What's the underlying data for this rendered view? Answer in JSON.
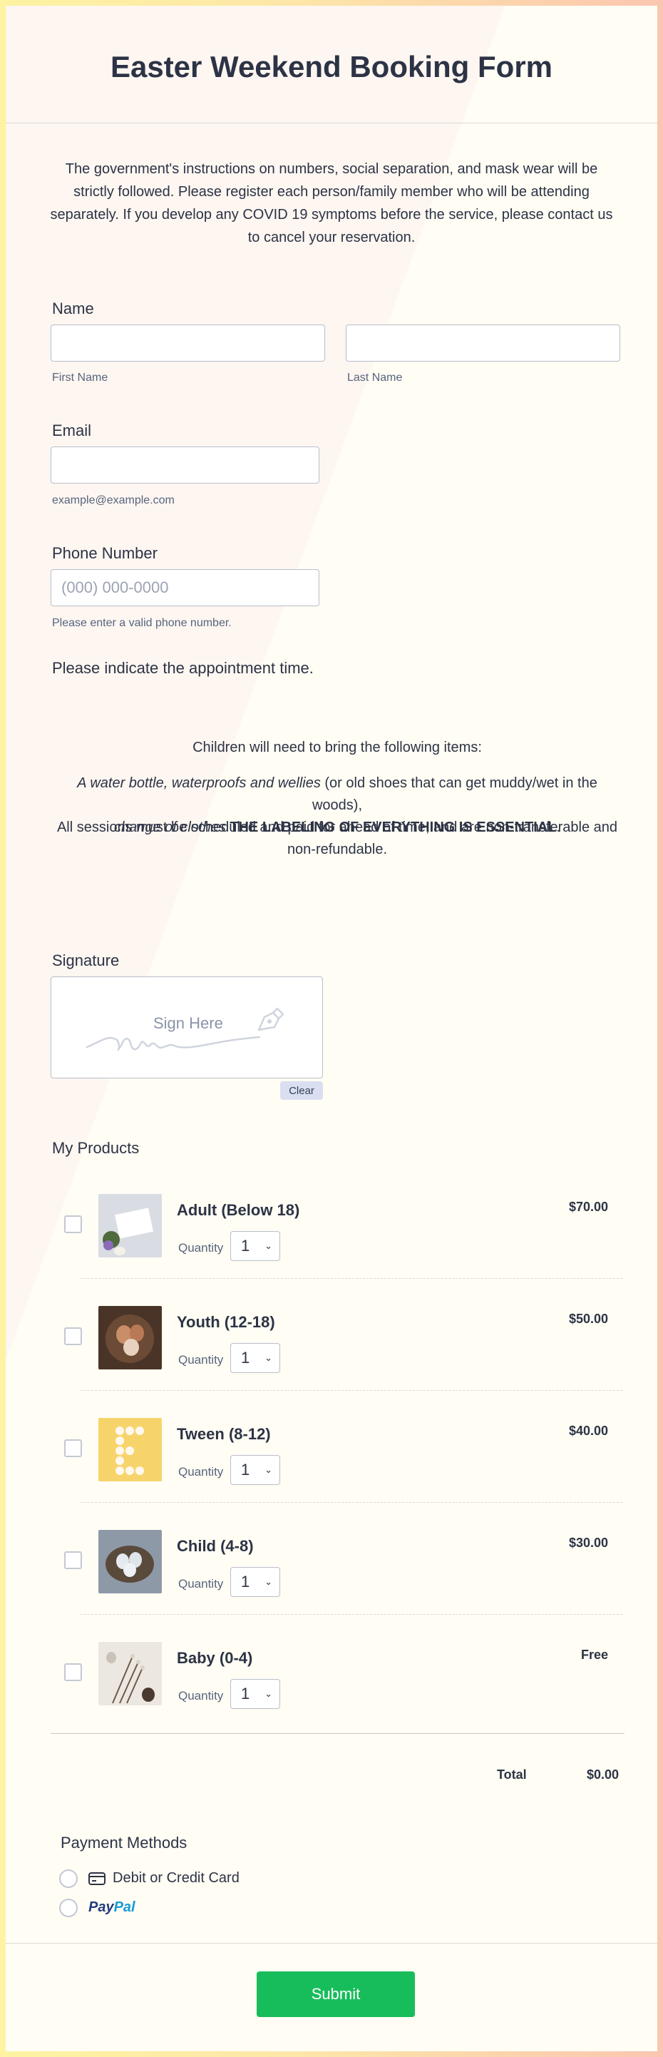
{
  "form": {
    "title": "Easter Weekend Booking Form",
    "intro": "The government's instructions on numbers, social separation, and mask wear will be strictly followed. Please register each person/family member who will be attending separately. If you develop any COVID 19 symptoms before the service, please contact us to cancel your reservation."
  },
  "name": {
    "label": "Name",
    "first_sublabel": "First Name",
    "last_sublabel": "Last Name"
  },
  "email": {
    "label": "Email",
    "sublabel": "example@example.com"
  },
  "phone": {
    "label": "Phone Number",
    "placeholder": "(000) 000-0000",
    "sublabel": "Please enter a valid phone number."
  },
  "appointment": {
    "label": "Please indicate the appointment time."
  },
  "notice": {
    "line1": "Children will need to bring the following items:",
    "items_italic_1": "A water bottle, waterproofs and wellies",
    "items_plain": " (or old shoes that can get muddy/wet in the woods),",
    "items_italic_2": "change of clothes",
    "items_bold": " THE LABELING OF EVERYTHING IS ESSENTIAL",
    "items_end": ".",
    "line3": "All sessions must be scheduled and paid for ahead of time, and are non-transferable and non-refundable."
  },
  "signature": {
    "label": "Signature",
    "placeholder": "Sign Here",
    "clear_label": "Clear"
  },
  "products": {
    "label": "My Products",
    "quantity_label": "Quantity",
    "items": [
      {
        "name": "Adult (Below 18)",
        "price": "$70.00",
        "qty": "1"
      },
      {
        "name": "Youth (12-18)",
        "price": "$50.00",
        "qty": "1"
      },
      {
        "name": "Tween (8-12)",
        "price": "$40.00",
        "qty": "1"
      },
      {
        "name": "Child (4-8)",
        "price": "$30.00",
        "qty": "1"
      },
      {
        "name": "Baby (0-4)",
        "price": "Free",
        "qty": "1"
      }
    ],
    "total_label": "Total",
    "total_value": "$0.00"
  },
  "payment": {
    "label": "Payment Methods",
    "card_label": "Debit or Credit Card",
    "paypal_label_1": "Pay",
    "paypal_label_2": "Pal"
  },
  "submit_label": "Submit",
  "colors": {
    "accent": "#18bd5b",
    "text": "#2c3345",
    "paypal_dark": "#253b80",
    "paypal_light": "#179bd7"
  },
  "icons": [
    "chevron-down-icon",
    "signature-pen-icon",
    "credit-card-icon",
    "paypal-logo"
  ]
}
